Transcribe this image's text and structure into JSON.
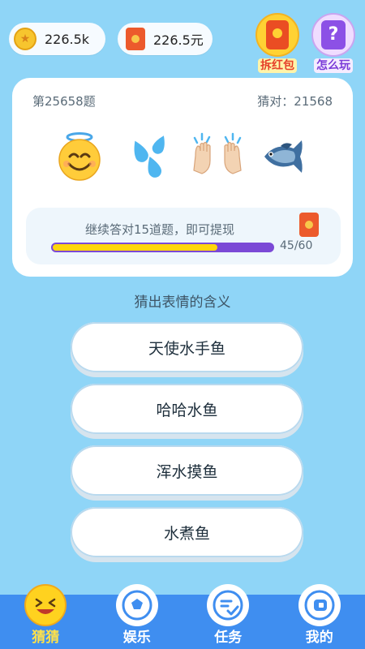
{
  "topbar": {
    "coins": "226.5k",
    "cash": "226.5元",
    "redpack_label": "拆红包",
    "howto_label": "怎么玩"
  },
  "question": {
    "number_label": "第25658题",
    "correct_label": "猜对：21568",
    "emoji_icons": [
      "smiling-face-with-halo-icon",
      "sweat-droplets-icon",
      "raising-hands-icon",
      "fish-icon"
    ]
  },
  "progress": {
    "hint": "继续答对15道题，即可提现",
    "count_text": "45/60",
    "current": 45,
    "total": 60
  },
  "prompt": "猜出表情的含义",
  "answers": [
    "天使水手鱼",
    "哈哈水鱼",
    "浑水摸鱼",
    "水煮鱼"
  ],
  "nav": [
    {
      "label": "猜猜",
      "icon": "laughing-face-icon",
      "active": true
    },
    {
      "label": "娱乐",
      "icon": "soccer-ball-icon",
      "active": false
    },
    {
      "label": "任务",
      "icon": "task-check-icon",
      "active": false
    },
    {
      "label": "我的",
      "icon": "profile-icon",
      "active": false
    }
  ],
  "colors": {
    "background": "#8fd5f7",
    "nav_bar": "#3f8ef0",
    "progress_fill": "#ffd60a",
    "progress_track": "#7b49d6",
    "accent_red": "#ec5a2c"
  }
}
